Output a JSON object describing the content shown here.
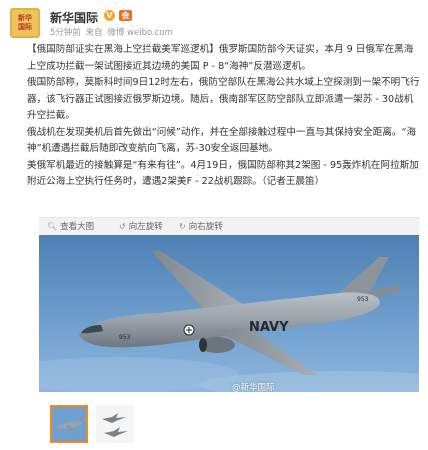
{
  "post": {
    "author": {
      "name": "新华国际",
      "avatar_line1": "新华",
      "avatar_line2": "国际",
      "verified_badge": "V",
      "member_icon": "会",
      "icons": [
        "verified-v-badge-icon",
        "member-crown-icon"
      ]
    },
    "meta": {
      "time": "5分钟前",
      "via": "来自",
      "client": "微博 weibo.com"
    },
    "text": [
      "【俄国防部证实在黑海上空拦截美军巡逻机】俄罗斯国防部今天证实，本月 9 日俄军在黑海上空成功拦截一架试图接近其边境的美国 P - 8“海神”反潜巡逻机。",
      "俄国防部称，莫斯科时间9日12时左右，俄防空部队在黑海公共水域上空探测到一架不明飞行器，该飞行器正试图接近俄罗斯边境。随后，俄南部军区防空部队立即派遣一架苏 - 30战机升空拦截。",
      "俄战机在发现美机后首先做出“问候”动作，并在全部接触过程中一直与其保持安全距离。“海神”机遭遇拦截后随即改变航向飞离，苏-30安全返回基地。",
      "美俄军机最近的接触算是“有来有往”。4月19日，俄国防部称其2架图 - 95轰炸机在阿拉斯加附近公海上空执行任务时，遭遇2架美F - 22战机跟踪。（记者王晨笛）"
    ],
    "attachment_bar": {
      "view_large": "查看大图",
      "rotate_left": "向左旋转",
      "rotate_right": "向右旋转",
      "icons": [
        "magnifier-icon",
        "rotate-left-icon",
        "rotate-right-icon"
      ]
    },
    "photo": {
      "subject": "US Navy P-8 Poseidon patrol aircraft in flight",
      "fuselage_text": "NAVY",
      "tail_number": "953",
      "nose_number": "953",
      "watermark": "@新华国际"
    },
    "thumbnails": [
      {
        "selected": true,
        "subject": "P-8 aircraft"
      },
      {
        "selected": false,
        "subject": "fighter jets"
      }
    ],
    "colors": {
      "sky": "#6f9fcf",
      "aircraft": "#9aa3ab",
      "selected_thumb_border": "#f28a1a",
      "badge": "#f6a623"
    }
  }
}
